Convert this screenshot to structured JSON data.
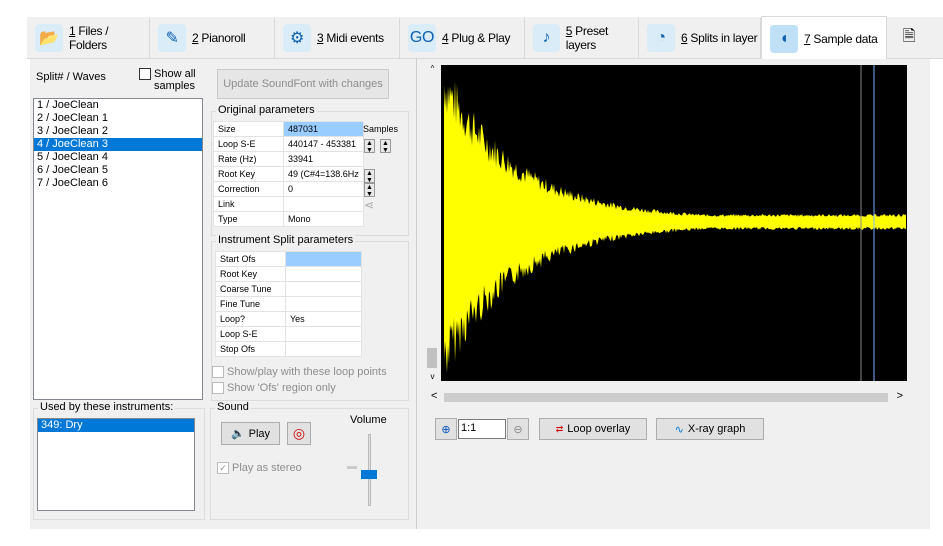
{
  "tabs": [
    {
      "key": "1",
      "label": " Files / Folders",
      "icon": "folder-music-icon",
      "active": false
    },
    {
      "key": "2",
      "label": " Pianoroll",
      "icon": "pianoroll-icon",
      "active": false
    },
    {
      "key": "3",
      "label": " Midi events",
      "icon": "midi-events-icon",
      "active": false
    },
    {
      "key": "4",
      "label": " Plug & Play",
      "icon": "go-icon",
      "active": false
    },
    {
      "key": "5",
      "label": " Preset layers",
      "icon": "saxophone-icon",
      "active": false
    },
    {
      "key": "6",
      "label": " Splits in layer",
      "icon": "gauge-icon",
      "active": false
    },
    {
      "key": "7",
      "label": " Sample data",
      "icon": "speaker-icon",
      "active": true
    }
  ],
  "waves": {
    "header": "Split# / Waves",
    "show_all": "Show all samples",
    "items": [
      "1 / JoeClean",
      "2 / JoeClean 1",
      "3 / JoeClean 2",
      "4 / JoeClean 3",
      "5 / JoeClean 4",
      "6 / JoeClean 5",
      "7 / JoeClean 6"
    ],
    "selected": 3
  },
  "update_button": "Update SoundFont with changes",
  "original": {
    "title": "Original parameters",
    "samples_label": "Samples",
    "rows": [
      [
        "Size",
        "487031"
      ],
      [
        "Loop S-E",
        "440147 - 453381"
      ],
      [
        "Rate (Hz)",
        "33941"
      ],
      [
        "Root Key",
        "49 (C#4=138.6Hz"
      ],
      [
        "Correction",
        "0"
      ],
      [
        "Link",
        ""
      ],
      [
        "Type",
        "Mono"
      ]
    ]
  },
  "split": {
    "title": "Instrument Split parameters",
    "rows": [
      [
        "Start Ofs",
        ""
      ],
      [
        "Root Key",
        ""
      ],
      [
        "Coarse Tune",
        ""
      ],
      [
        "Fine Tune",
        ""
      ],
      [
        "Loop?",
        "Yes"
      ],
      [
        "Loop S-E",
        ""
      ],
      [
        "Stop Ofs",
        ""
      ]
    ],
    "show_loop": "Show/play with these loop points",
    "show_ofs": "Show 'Ofs' region only"
  },
  "instruments": {
    "title": "Used by these instruments:",
    "items": [
      "349: Dry"
    ]
  },
  "sound": {
    "title": "Sound",
    "play": "Play",
    "stereo": "Play as stereo",
    "volume": "Volume",
    "volume_level": 0.45
  },
  "graph": {
    "zoom": "1:1",
    "loop_overlay": "Loop overlay",
    "xray": "X-ray graph",
    "wave_color": "#ffff00",
    "bg_color": "#000000"
  }
}
